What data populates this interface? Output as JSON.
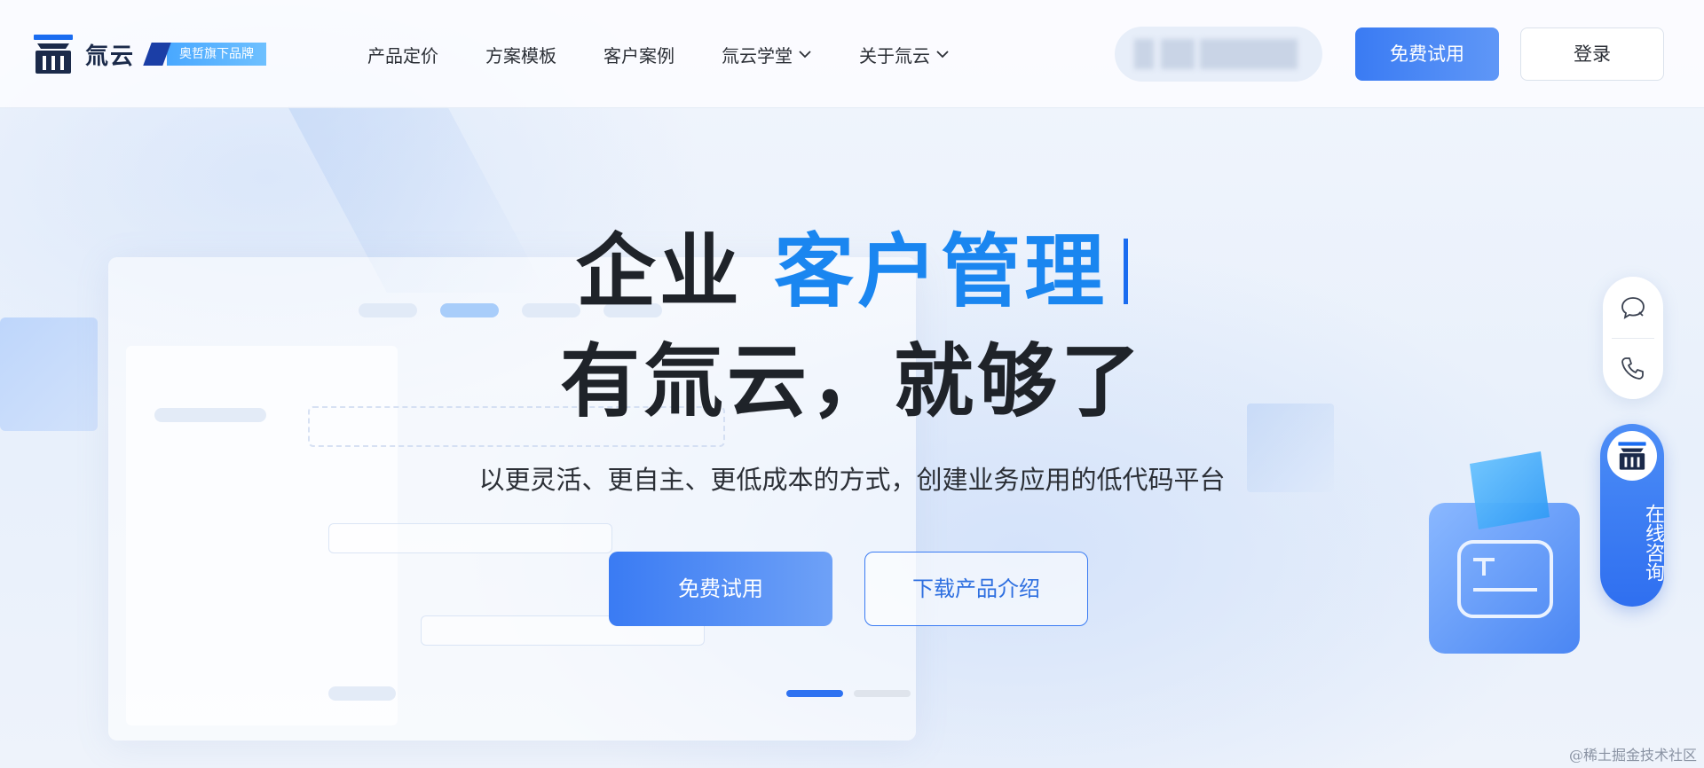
{
  "header": {
    "logo_text": "氚云",
    "brand_badge": "奥哲旗下品牌",
    "nav": [
      {
        "label": "产品定价",
        "has_dropdown": false
      },
      {
        "label": "方案模板",
        "has_dropdown": false
      },
      {
        "label": "客户案例",
        "has_dropdown": false
      },
      {
        "label": "氚云学堂",
        "has_dropdown": true
      },
      {
        "label": "关于氚云",
        "has_dropdown": true
      }
    ],
    "trial_button": "免费试用",
    "login_button": "登录"
  },
  "hero": {
    "headline_prefix": "企业",
    "headline_highlight": "客户管理",
    "headline_line2": "有氚云，就够了",
    "subtitle": "以更灵活、更自主、更低成本的方式，创建业务应用的低代码平台",
    "trial_button": "免费试用",
    "download_button": "下载产品介绍",
    "carousel": {
      "slides": 2,
      "active_index": 0
    }
  },
  "float": {
    "chat_icon": "chat-bubble-icon",
    "phone_icon": "phone-icon",
    "consult_label": "在线咨询"
  },
  "colors": {
    "primary": "#3a7bf3",
    "highlight": "#1a86f0",
    "text_dark": "#1f2329",
    "badge": "#49a8ff"
  },
  "watermark": "@稀土掘金技术社区"
}
